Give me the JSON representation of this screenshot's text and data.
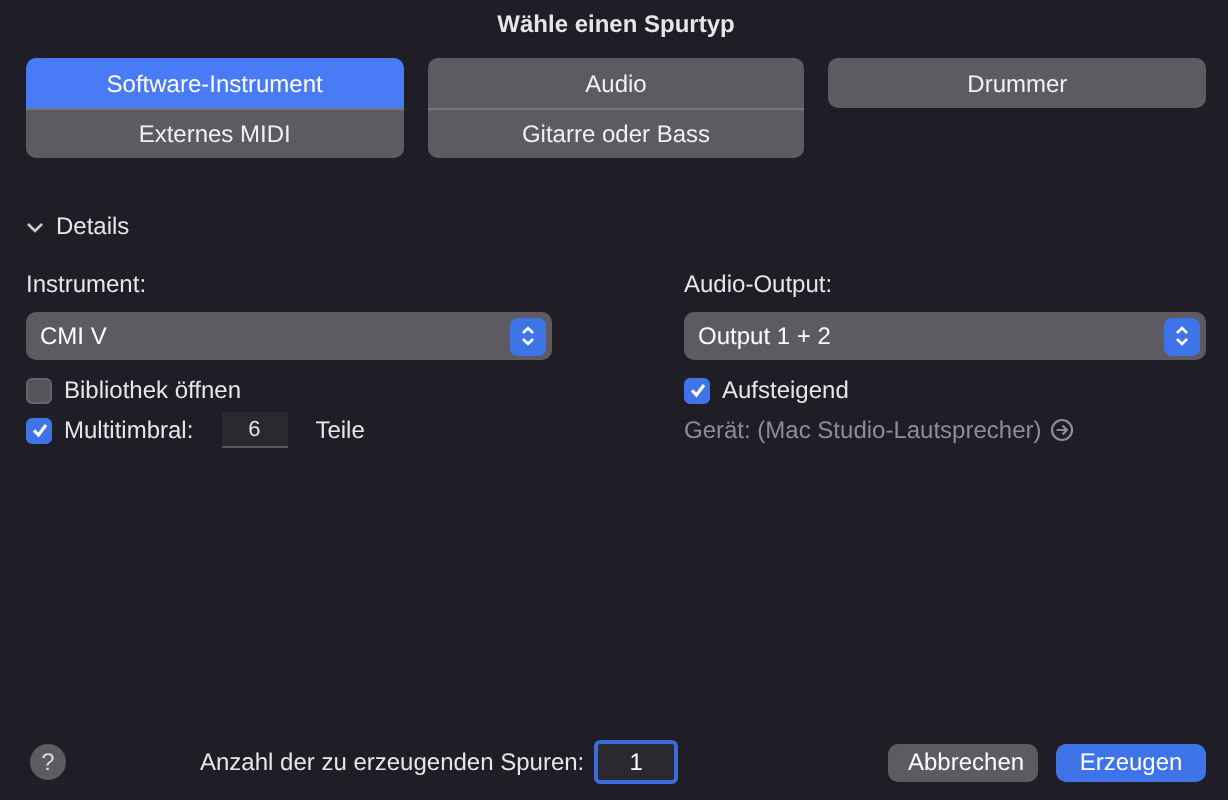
{
  "window": {
    "title": "Wähle einen Spurtyp"
  },
  "track_types": [
    {
      "label": "Software-Instrument",
      "selected": true
    },
    {
      "label": "Audio",
      "selected": false
    },
    {
      "label": "Drummer",
      "selected": false
    },
    {
      "label": "Externes MIDI",
      "selected": false
    },
    {
      "label": "Gitarre oder Bass",
      "selected": false
    }
  ],
  "details": {
    "label": "Details",
    "expanded": true,
    "instrument": {
      "label": "Instrument:",
      "value": "CMI V"
    },
    "open_library": {
      "label": "Bibliothek öffnen",
      "checked": false
    },
    "multitimbral": {
      "label": "Multitimbral:",
      "checked": true,
      "value": "6",
      "suffix": "Teile"
    },
    "audio_output": {
      "label": "Audio-Output:",
      "value": "Output 1 + 2"
    },
    "ascending": {
      "label": "Aufsteigend",
      "checked": true
    },
    "device": {
      "label": "Gerät: (Mac Studio-Lautsprecher)"
    }
  },
  "footer": {
    "help": "?",
    "count_label": "Anzahl der zu erzeugenden Spuren:",
    "count_value": "1",
    "buttons": [
      {
        "label": "Abbrechen",
        "kind": "cancel"
      },
      {
        "label": "Erzeugen",
        "kind": "default"
      }
    ]
  }
}
